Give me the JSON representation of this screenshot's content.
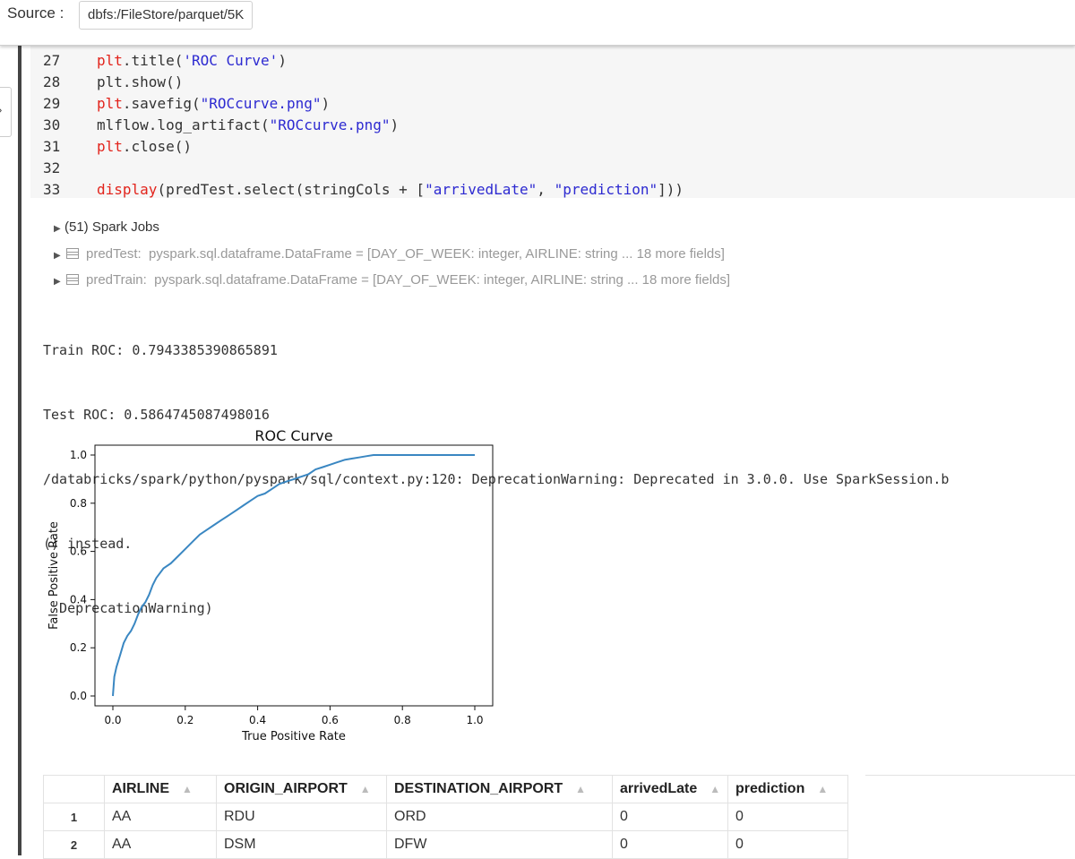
{
  "source": {
    "label": "Source :",
    "path": "dbfs:/FileStore/parquet/5K"
  },
  "code_lines": [
    {
      "n": "27",
      "parts": [
        [
          "kw",
          "plt"
        ],
        [
          "",
          "."
        ],
        [
          "",
          "title("
        ],
        [
          "str",
          "'ROC Curve'"
        ],
        [
          "",
          ")"
        ]
      ]
    },
    {
      "n": "28",
      "parts": [
        [
          "",
          "plt.show()"
        ]
      ]
    },
    {
      "n": "29",
      "parts": [
        [
          "kw",
          "plt"
        ],
        [
          "",
          ".savefig("
        ],
        [
          "str",
          "\"ROCcurve.png\""
        ],
        [
          "",
          ")"
        ]
      ]
    },
    {
      "n": "30",
      "parts": [
        [
          "",
          "mlflow.log_artifact("
        ],
        [
          "str",
          "\"ROCcurve.png\""
        ],
        [
          "",
          ")"
        ]
      ]
    },
    {
      "n": "31",
      "parts": [
        [
          "kw",
          "plt"
        ],
        [
          "",
          ".close()"
        ]
      ]
    },
    {
      "n": "32",
      "parts": []
    },
    {
      "n": "33",
      "parts": [
        [
          "kw",
          "display"
        ],
        [
          "",
          "(predTest.select(stringCols + ["
        ],
        [
          "str",
          "\"arrivedLate\""
        ],
        [
          "",
          ", "
        ],
        [
          "str",
          "\"prediction\""
        ],
        [
          "",
          "]))"
        ]
      ]
    }
  ],
  "spark_jobs": "(51) Spark Jobs",
  "dataframes": [
    {
      "name": "predTest:",
      "schema": "pyspark.sql.dataframe.DataFrame = [DAY_OF_WEEK: integer, AIRLINE: string ... 18 more fields]"
    },
    {
      "name": "predTrain:",
      "schema": "pyspark.sql.dataframe.DataFrame = [DAY_OF_WEEK: integer, AIRLINE: string ... 18 more fields]"
    }
  ],
  "stdout": [
    "Train ROC: 0.7943385390865891",
    "Test ROC: 0.5864745087498016",
    "/databricks/spark/python/pyspark/sql/context.py:120: DeprecationWarning: Deprecated in 3.0.0. Use SparkSession.b",
    "() instead.",
    "  DeprecationWarning)"
  ],
  "chart_data": {
    "type": "line",
    "title": "ROC Curve",
    "xlabel": "True Positive Rate",
    "ylabel": "False Positive Rate",
    "xlim": [
      0.0,
      1.0
    ],
    "ylim": [
      0.0,
      1.0
    ],
    "xticks": [
      "0.0",
      "0.2",
      "0.4",
      "0.6",
      "0.8",
      "1.0"
    ],
    "yticks": [
      "0.0",
      "0.2",
      "0.4",
      "0.6",
      "0.8",
      "1.0"
    ],
    "grid": false,
    "line_color": "#3a87c2",
    "x": [
      0.0,
      0.002,
      0.004,
      0.01,
      0.02,
      0.03,
      0.04,
      0.05,
      0.06,
      0.07,
      0.08,
      0.09,
      0.1,
      0.11,
      0.12,
      0.14,
      0.16,
      0.18,
      0.2,
      0.22,
      0.24,
      0.26,
      0.28,
      0.3,
      0.32,
      0.34,
      0.36,
      0.38,
      0.4,
      0.42,
      0.44,
      0.46,
      0.48,
      0.5,
      0.52,
      0.54,
      0.56,
      0.58,
      0.6,
      0.62,
      0.64,
      0.66,
      0.68,
      0.7,
      0.72,
      0.74,
      0.76,
      0.8,
      0.85,
      0.9,
      0.95,
      1.0
    ],
    "y": [
      0.0,
      0.04,
      0.08,
      0.12,
      0.17,
      0.22,
      0.25,
      0.27,
      0.3,
      0.34,
      0.37,
      0.39,
      0.42,
      0.46,
      0.49,
      0.53,
      0.55,
      0.58,
      0.61,
      0.64,
      0.67,
      0.69,
      0.71,
      0.73,
      0.75,
      0.77,
      0.79,
      0.81,
      0.83,
      0.84,
      0.86,
      0.88,
      0.89,
      0.9,
      0.91,
      0.92,
      0.94,
      0.95,
      0.96,
      0.97,
      0.98,
      0.985,
      0.99,
      0.995,
      1.0,
      1.0,
      1.0,
      1.0,
      1.0,
      1.0,
      1.0,
      1.0
    ]
  },
  "table": {
    "columns": [
      "AIRLINE",
      "ORIGIN_AIRPORT",
      "DESTINATION_AIRPORT",
      "arrivedLate",
      "prediction"
    ],
    "sort_icon": "sort-up-icon",
    "rows": [
      {
        "idx": "1",
        "cells": [
          "AA",
          "RDU",
          "ORD",
          "0",
          "0"
        ]
      },
      {
        "idx": "2",
        "cells": [
          "AA",
          "DSM",
          "DFW",
          "0",
          "0"
        ]
      }
    ]
  }
}
